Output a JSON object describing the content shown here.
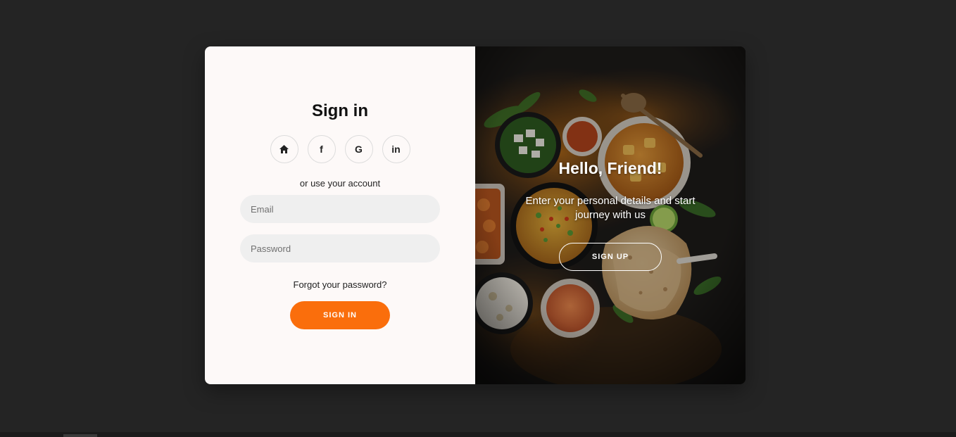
{
  "signin": {
    "title": "Sign in",
    "social": [
      {
        "icon": "home-icon"
      },
      {
        "icon": "facebook-icon",
        "glyph": "f"
      },
      {
        "icon": "google-icon",
        "glyph": "G"
      },
      {
        "icon": "linkedin-icon",
        "glyph": "in"
      }
    ],
    "subtitle": "or use your account",
    "email_placeholder": "Email",
    "email_value": "",
    "password_placeholder": "Password",
    "password_value": "",
    "forgot": "Forgot your password?",
    "button": "SIGN IN"
  },
  "panel": {
    "title": "Hello, Friend!",
    "text": "Enter your personal details and start journey with us",
    "button": "SIGN UP"
  },
  "colors": {
    "accent": "#fa6e0c",
    "page_background": "#242424",
    "form_background": "#fdf9f8",
    "input_background": "#efefef"
  }
}
